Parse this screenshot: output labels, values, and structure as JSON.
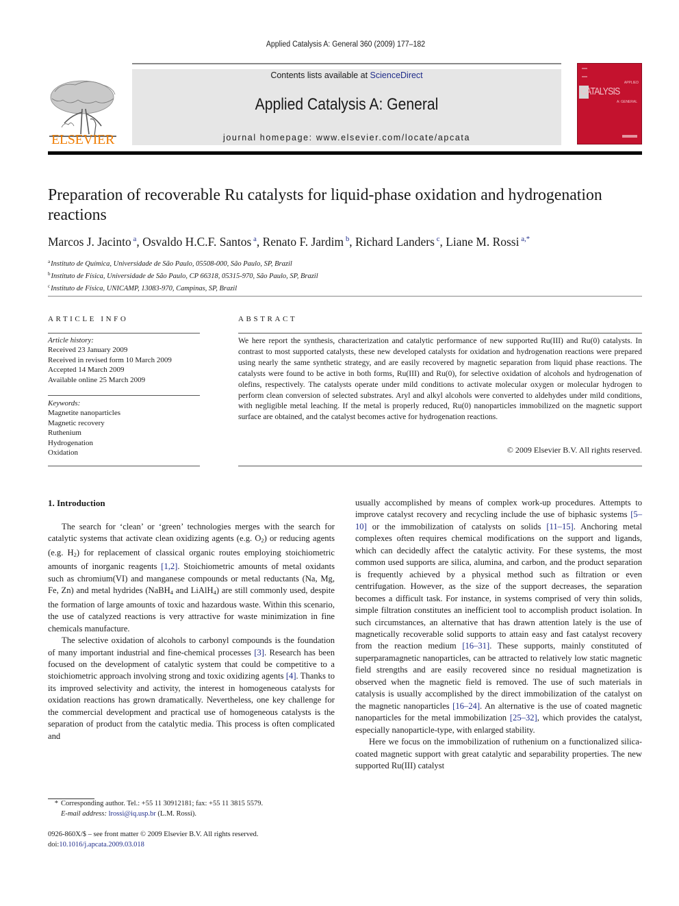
{
  "header": {
    "journal_reference": "Applied Catalysis A: General 360 (2009) 177–182",
    "contents_prefix": "Contents lists available at ",
    "contents_link": "ScienceDirect",
    "journal_title": "Applied Catalysis A: General",
    "homepage_label": "journal homepage: ",
    "homepage_url": "www.elsevier.com/locate/apcata",
    "publisher_logo_text": "ELSEVIER",
    "cover": {
      "title": "CATALYSIS",
      "top_label": "APPLIED",
      "sub_label": "A: GENERAL"
    }
  },
  "colors": {
    "link": "#1f2c8a",
    "elsevier_orange": "#f07c00",
    "cover_red": "#c4122e",
    "masthead_gray": "#e6e6e6"
  },
  "article": {
    "title": "Preparation of recoverable Ru catalysts for liquid-phase oxidation and hydrogenation reactions",
    "authors": [
      {
        "name": "Marcos J. Jacinto",
        "sup": "a"
      },
      {
        "name": "Osvaldo H.C.F. Santos",
        "sup": "a"
      },
      {
        "name": "Renato F. Jardim",
        "sup": "b"
      },
      {
        "name": "Richard Landers",
        "sup": "c"
      },
      {
        "name": "Liane M. Rossi",
        "sup": "a,*"
      }
    ],
    "affiliations": [
      {
        "key": "a",
        "text": "Instituto de Química, Universidade de São Paulo, 05508-000, São Paulo, SP, Brazil"
      },
      {
        "key": "b",
        "text": "Instituto de Física, Universidade de São Paulo, CP 66318, 05315-970, São Paulo, SP, Brazil"
      },
      {
        "key": "c",
        "text": "Instituto de Física, UNICAMP, 13083-970, Campinas, SP, Brazil"
      }
    ]
  },
  "article_info": {
    "heading": "ARTICLE INFO",
    "history_label": "Article history:",
    "history": [
      "Received 23 January 2009",
      "Received in revised form 10 March 2009",
      "Accepted 14 March 2009",
      "Available online 25 March 2009"
    ],
    "keywords_label": "Keywords:",
    "keywords": [
      "Magnetite nanoparticles",
      "Magnetic recovery",
      "Ruthenium",
      "Hydrogenation",
      "Oxidation"
    ]
  },
  "abstract": {
    "heading": "ABSTRACT",
    "text": "We here report the synthesis, characterization and catalytic performance of new supported Ru(III) and Ru(0) catalysts. In contrast to most supported catalysts, these new developed catalysts for oxidation and hydrogenation reactions were prepared using nearly the same synthetic strategy, and are easily recovered by magnetic separation from liquid phase reactions. The catalysts were found to be active in both forms, Ru(III) and Ru(0), for selective oxidation of alcohols and hydrogenation of olefins, respectively. The catalysts operate under mild conditions to activate molecular oxygen or molecular hydrogen to perform clean conversion of selected substrates. Aryl and alkyl alcohols were converted to aldehydes under mild conditions, with negligible metal leaching. If the metal is properly reduced, Ru(0) nanoparticles immobilized on the magnetic support surface are obtained, and the catalyst becomes active for hydrogenation reactions.",
    "copyright": "© 2009 Elsevier B.V. All rights reserved."
  },
  "introduction": {
    "heading": "1.  Introduction",
    "p1": {
      "t1": "The search for ‘clean’ or ‘green’ technologies merges with the search for catalytic systems that activate clean oxidizing agents (e.g. O",
      "s1": "2",
      "t2": ") or reducing agents (e.g. H",
      "s2": "2",
      "t3": ") for replacement of classical organic routes employing stoichiometric amounts of inorganic reagents ",
      "r1": "[1,2]",
      "t4": ". Stoichiometric amounts of metal oxidants such as chromium(VI) and manganese compounds or metal reductants (Na, Mg, Fe, Zn) and metal hydrides (NaBH",
      "s3": "4",
      "t5": " and LiAlH",
      "s4": "4",
      "t6": ") are still commonly used, despite the formation of large amounts of toxic and hazardous waste. Within this scenario, the use of catalyzed reactions is very attractive for waste minimization in fine chemicals manufacture."
    },
    "p2": {
      "t1": "The selective oxidation of alcohols to carbonyl compounds is the foundation of many important industrial and fine-chemical processes ",
      "r1": "[3]",
      "t2": ". Research has been focused on the development of catalytic system that could be competitive to a stoichiometric approach involving strong and toxic oxidizing agents ",
      "r2": "[4]",
      "t3": ". Thanks to its improved selectivity and activity, the interest in homogeneous catalysts for oxidation reactions has grown dramatically. Nevertheless, one key challenge for the commercial development and practical use of homogeneous catalysts is the separation of product from the catalytic media. This process is often complicated and"
    },
    "p3": {
      "t1": "usually accomplished by means of complex work-up procedures. Attempts to improve catalyst recovery and recycling include the use of biphasic systems ",
      "r1": "[5–10]",
      "t2": " or the immobilization of catalysts on solids ",
      "r2": "[11–15]",
      "t3": ". Anchoring metal complexes often requires chemical modifications on the support and ligands, which can decidedly affect the catalytic activity. For these systems, the most common used supports are silica, alumina, and carbon, and the product separation is frequently achieved by a physical method such as filtration or even centrifugation. However, as the size of the support decreases, the separation becomes a difficult task. For instance, in systems comprised of very thin solids, simple filtration constitutes an inefficient tool to accomplish product isolation. In such circumstances, an alternative that has drawn attention lately is the use of magnetically recoverable solid supports to attain easy and fast catalyst recovery from the reaction medium ",
      "r3": "[16–31]",
      "t4": ". These supports, mainly constituted of superparamagnetic nanoparticles, can be attracted to relatively low static magnetic field strengths and are easily recovered since no residual magnetization is observed when the magnetic field is removed. The use of such materials in catalysis is usually accomplished by the direct immobilization of the catalyst on the magnetic nanoparticles ",
      "r4": "[16–24]",
      "t5": ". An alternative is the use of coated magnetic nanoparticles for the metal immobilization ",
      "r5": "[25–32]",
      "t6": ", which provides the catalyst, especially nanoparticle-type, with enlarged stability."
    },
    "p4": {
      "t1": "Here we focus on the immobilization of ruthenium on a functionalized silica-coated magnetic support with great catalytic and separability properties. The new supported Ru(III) catalyst"
    }
  },
  "footnotes": {
    "star": "*",
    "corresponding": "Corresponding author. Tel.: +55 11 30912181; fax: +55 11 3815 5579.",
    "email_label": "E-mail address: ",
    "email": "lrossi@iq.usp.br",
    "email_suffix": " (L.M. Rossi).",
    "front_matter": "0926-860X/$ – see front matter © 2009 Elsevier B.V. All rights reserved.",
    "doi_label": "doi:",
    "doi": "10.1016/j.apcata.2009.03.018"
  }
}
